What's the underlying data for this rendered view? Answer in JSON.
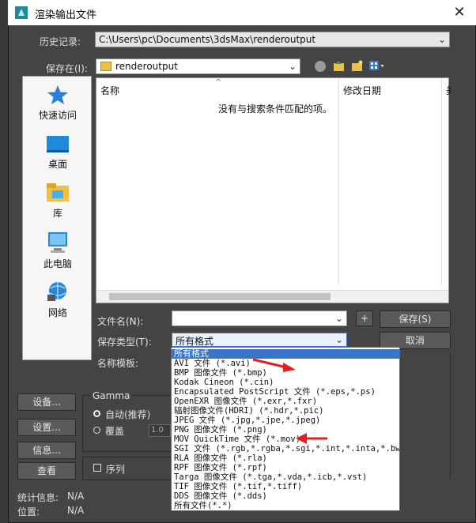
{
  "dialog": {
    "title": "渲染输出文件",
    "close_glyph": "✕"
  },
  "history": {
    "label": "历史记录:",
    "value": "C:\\Users\\pc\\Documents\\3dsMax\\renderoutput"
  },
  "save_in": {
    "label": "保存在(I):",
    "value": "renderoutput"
  },
  "places": [
    {
      "label": "快速访问",
      "icon": "star-icon"
    },
    {
      "label": "桌面",
      "icon": "desktop-icon"
    },
    {
      "label": "库",
      "icon": "library-icon"
    },
    {
      "label": "此电脑",
      "icon": "computer-icon"
    },
    {
      "label": "网络",
      "icon": "network-icon"
    }
  ],
  "filelist": {
    "columns": [
      "名称",
      "修改日期",
      "美"
    ],
    "empty_message": "没有与搜索条件匹配的项。"
  },
  "filename": {
    "label": "文件名(N):",
    "value": ""
  },
  "filetype": {
    "label": "保存类型(T):",
    "value": "所有格式"
  },
  "name_template": {
    "label": "名称模板:"
  },
  "buttons": {
    "plus": "+",
    "save": "保存(S)",
    "cancel": "取消"
  },
  "type_options": [
    "所有格式",
    "AVI 文件 (*.avi)",
    "BMP 图像文件 (*.bmp)",
    "Kodak Cineon (*.cin)",
    "Encapsulated PostScript 文件 (*.eps,*.ps)",
    "OpenEXR 图像文件 (*.exr,*.fxr)",
    "辐射图像文件(HDRI) (*.hdr,*.pic)",
    "JPEG 文件 (*.jpg,*.jpe,*.jpeg)",
    "PNG 图像文件 (*.png)",
    "MOV QuickTime 文件 (*.mov)",
    "SGI 文件 (*.rgb,*.rgba,*.sgi,*.int,*.inta,*.bw)",
    "RLA 图像文件 (*.rla)",
    "RPF 图像文件 (*.rpf)",
    "Targa 图像文件 (*.tga,*.vda,*.icb,*.vst)",
    "TIF 图像文件 (*.tif,*.tiff)",
    "DDS 图像文件 (*.dds)",
    "所有文件(*.*)"
  ],
  "lower": {
    "setup_btn": "设备...",
    "settings_btn": "设置...",
    "info_btn": "信息...",
    "view_btn": "查看",
    "gamma_title": "Gamma",
    "auto_label": "自动(推荐)",
    "override_label": "覆盖",
    "override_value": "1.0",
    "sequence_label": "序列",
    "stats_label": "统计信息:",
    "stats_value": "N/A",
    "location_label": "位置:",
    "location_value": "N/A"
  },
  "colors": {
    "selection": "#3874c8",
    "arrow": "#e02020",
    "dialog_bg": "#444444"
  }
}
